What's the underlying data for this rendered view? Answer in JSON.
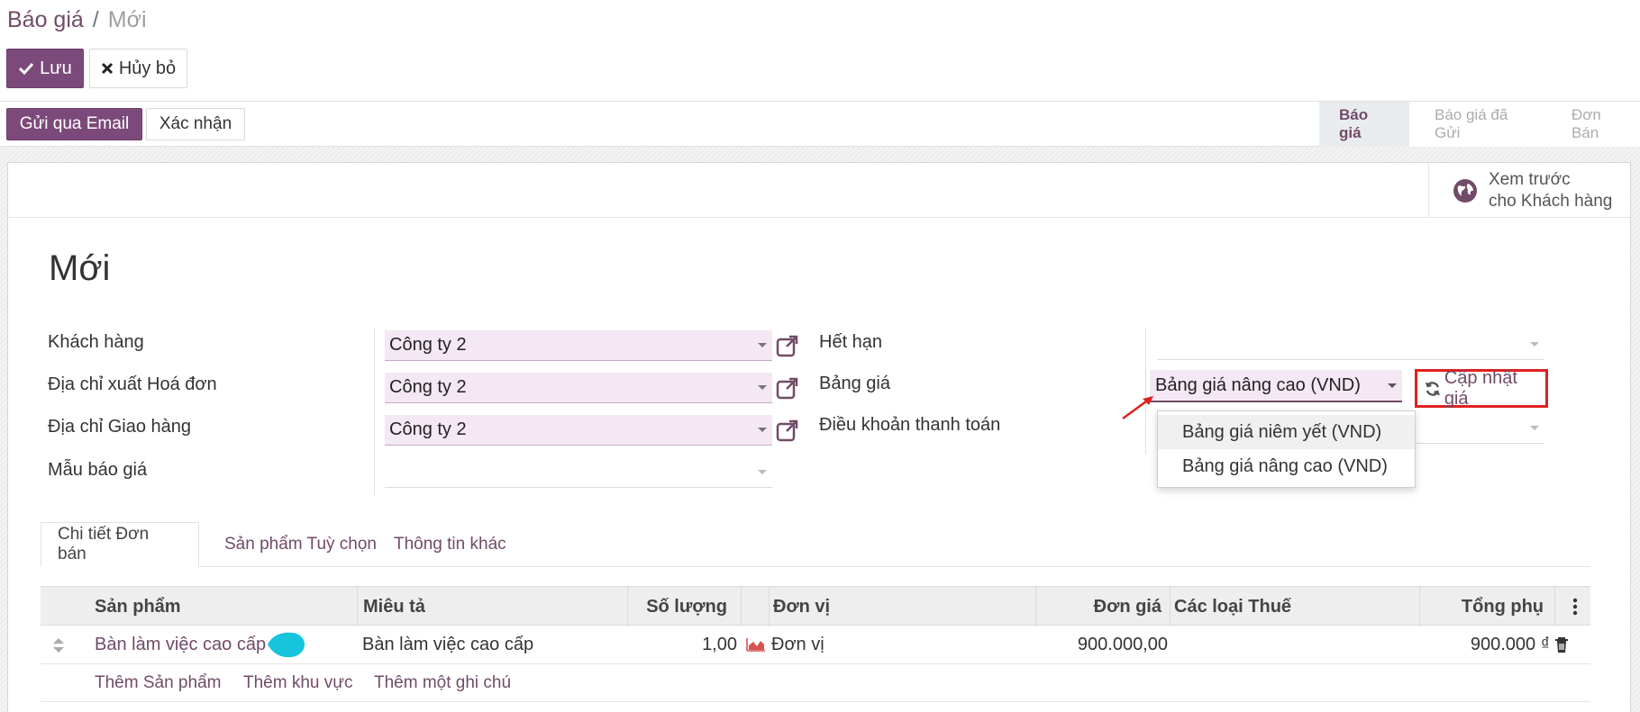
{
  "breadcrumb": {
    "parent": "Báo giá",
    "separator": "/",
    "current": "Mới"
  },
  "actions": {
    "save_label": "Lưu",
    "discard_label": "Hủy bỏ"
  },
  "header_buttons": {
    "send_email": "Gửi qua Email",
    "confirm": "Xác nhận"
  },
  "statusbar": {
    "steps": [
      "Báo giá",
      "Báo giá đã Gửi",
      "Đơn Bán"
    ],
    "active": "Báo giá"
  },
  "button_box": {
    "preview_line1": "Xem trước",
    "preview_line2": "cho Khách hàng"
  },
  "record": {
    "title": "Mới"
  },
  "left_fields": {
    "customer": {
      "label": "Khách hàng",
      "value": "Công ty 2"
    },
    "invoice_address": {
      "label": "Địa chỉ xuất Hoá đơn",
      "value": "Công ty 2"
    },
    "delivery_address": {
      "label": "Địa chỉ Giao hàng",
      "value": "Công ty 2"
    },
    "quotation_template": {
      "label": "Mẫu báo giá",
      "value": ""
    }
  },
  "right_fields": {
    "expiration": {
      "label": "Hết hạn",
      "value": ""
    },
    "pricelist": {
      "label": "Bảng giá",
      "value": "Bảng giá nâng cao (VND)"
    },
    "payment_terms": {
      "label": "Điều khoản thanh toán",
      "value": ""
    }
  },
  "update_price_label": "Cập nhật giá",
  "pricelist_options": [
    "Bảng giá niêm yết (VND)",
    "Bảng giá nâng cao (VND)"
  ],
  "tabs": [
    "Chi tiết Đơn bán",
    "Sản phẩm Tuỳ chọn",
    "Thông tin khác"
  ],
  "order_lines": {
    "columns": [
      "Sản phẩm",
      "Miêu tả",
      "Số lượng",
      "Đơn vị",
      "Đơn giá",
      "Các loại Thuế",
      "Tổng phụ"
    ],
    "rows": [
      {
        "product": "Bàn làm việc cao cấp",
        "description": "Bàn làm việc cao cấp",
        "quantity": "1,00",
        "uom": "Đơn vị",
        "unit_price": "900.000,00",
        "taxes": "",
        "subtotal": "900.000 ₫"
      }
    ],
    "add_links": [
      "Thêm Sản phẩm",
      "Thêm khu vực",
      "Thêm một ghi chú"
    ]
  },
  "colors": {
    "brand": "#714b67",
    "primary_button": "#7c4a7a",
    "highlight_border": "#e02020",
    "annotation_dot": "#16c5dc"
  }
}
